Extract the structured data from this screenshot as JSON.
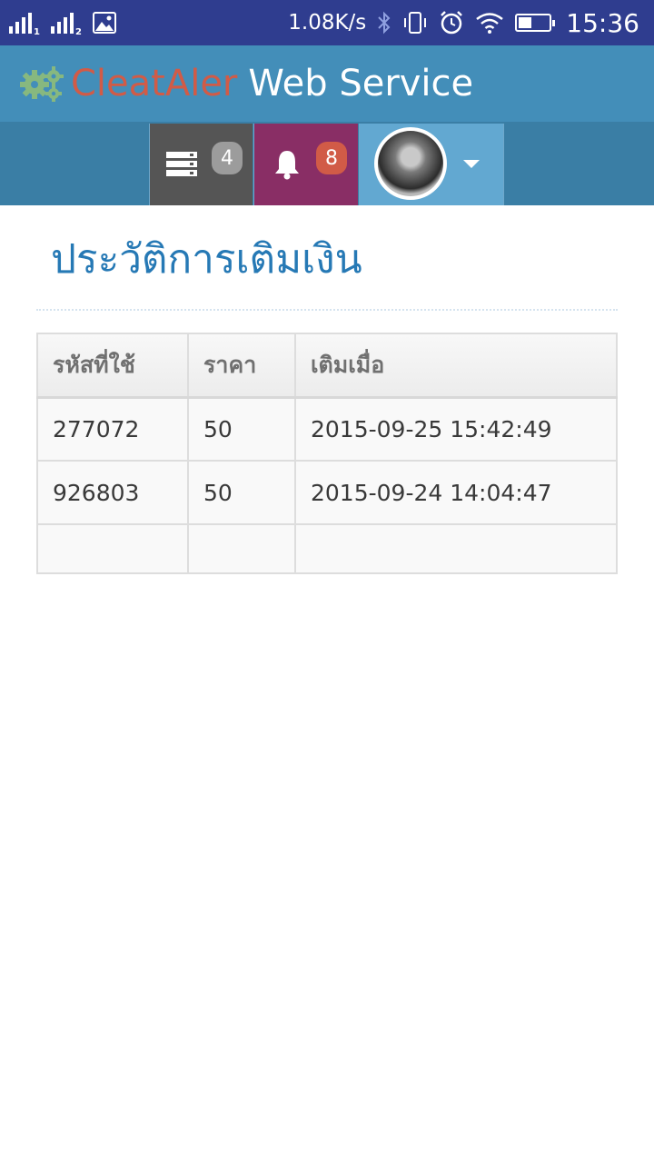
{
  "status_bar": {
    "sim1_label": "1",
    "sim2_label": "2",
    "network_speed": "1.08K/s",
    "time": "15:36",
    "battery_level": 0.45,
    "icons": [
      "signal-icon",
      "signal-icon",
      "image-icon",
      "bluetooth-icon",
      "vibrate-icon",
      "alarm-icon",
      "wifi-icon",
      "battery-icon"
    ]
  },
  "header": {
    "brand_accent": "CleatAler",
    "brand_rest": "Web Service",
    "logo_icon": "gears-icon",
    "colors": {
      "header_bg": "#438eb9",
      "accent": "#d15b47",
      "gears": "#87b87f"
    }
  },
  "nav": {
    "tasks_badge": "4",
    "notifications_badge": "8",
    "tasks_icon": "tasks-icon",
    "notifications_icon": "bell-icon",
    "user_menu_icon": "caret-down-icon"
  },
  "page": {
    "title": "ประวัติการเติมเงิน"
  },
  "table": {
    "headers": [
      "รหัสที่ใช้",
      "ราคา",
      "เติมเมื่อ"
    ],
    "rows": [
      [
        "277072",
        "50",
        "2015-09-25 15:42:49"
      ],
      [
        "926803",
        "50",
        "2015-09-24 14:04:47"
      ],
      [
        "",
        "",
        ""
      ]
    ]
  }
}
